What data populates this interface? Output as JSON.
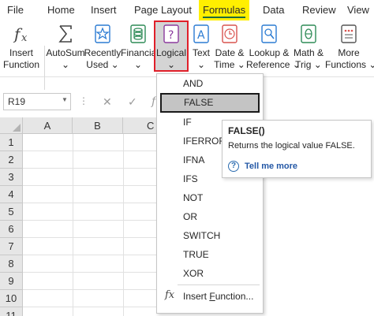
{
  "tabs": [
    {
      "label": "File"
    },
    {
      "label": "Home"
    },
    {
      "label": "Insert"
    },
    {
      "label": "Page Layout"
    },
    {
      "label": "Formulas"
    },
    {
      "label": "Data"
    },
    {
      "label": "Review"
    },
    {
      "label": "View"
    }
  ],
  "active_tab": "Formulas",
  "colors": {
    "active_tab_highlight": "#ffef00",
    "logical_outline": "#e0202a",
    "link_blue": "#2458a6",
    "selected_row": "#c4c4c4"
  },
  "ribbon": {
    "insert_function": {
      "line1": "Insert",
      "line2": "Function",
      "icon": "fx-icon"
    },
    "autosum": {
      "line1": "AutoSum",
      "arrow": "⌄",
      "icon": "sigma-icon"
    },
    "recently_used": {
      "line1": "Recently",
      "line2": "Used",
      "arrow": "⌄",
      "icon": "star-book-icon"
    },
    "financial": {
      "line1": "Financial",
      "arrow": "⌄",
      "icon": "coins-icon"
    },
    "logical": {
      "line1": "Logical",
      "arrow": "⌄",
      "icon": "question-book-icon"
    },
    "text": {
      "line1": "Text",
      "arrow": "⌄",
      "icon": "letter-a-book-icon"
    },
    "date_time": {
      "line1": "Date &",
      "line2": "Time",
      "arrow": "⌄",
      "icon": "clock-book-icon"
    },
    "lookup": {
      "line1": "Lookup &",
      "line2": "Reference",
      "arrow": "⌄",
      "icon": "magnifier-book-icon"
    },
    "math": {
      "line1": "Math &",
      "line2": "Trig",
      "arrow": "⌄",
      "icon": "theta-book-icon"
    },
    "more": {
      "line1": "More",
      "line2": "Functions",
      "arrow": "⌄",
      "icon": "dots-book-icon"
    }
  },
  "formula_bar": {
    "name_box": "R19",
    "cancel": "✕",
    "enter": "✓",
    "fx": "f"
  },
  "grid": {
    "columns": [
      "A",
      "B",
      "C"
    ],
    "rows": [
      "1",
      "2",
      "3",
      "4",
      "5",
      "6",
      "7",
      "8",
      "9",
      "10",
      "11"
    ]
  },
  "logical_menu": {
    "items": [
      "AND",
      "FALSE",
      "IF",
      "IFERROR",
      "IFNA",
      "IFS",
      "NOT",
      "OR",
      "SWITCH",
      "TRUE",
      "XOR"
    ],
    "highlighted": "FALSE",
    "insert_function": {
      "prefix": "Insert ",
      "underlined": "F",
      "suffix": "unction..."
    }
  },
  "tooltip": {
    "title": "FALSE()",
    "description": "Returns the logical value FALSE.",
    "link": "Tell me more"
  }
}
